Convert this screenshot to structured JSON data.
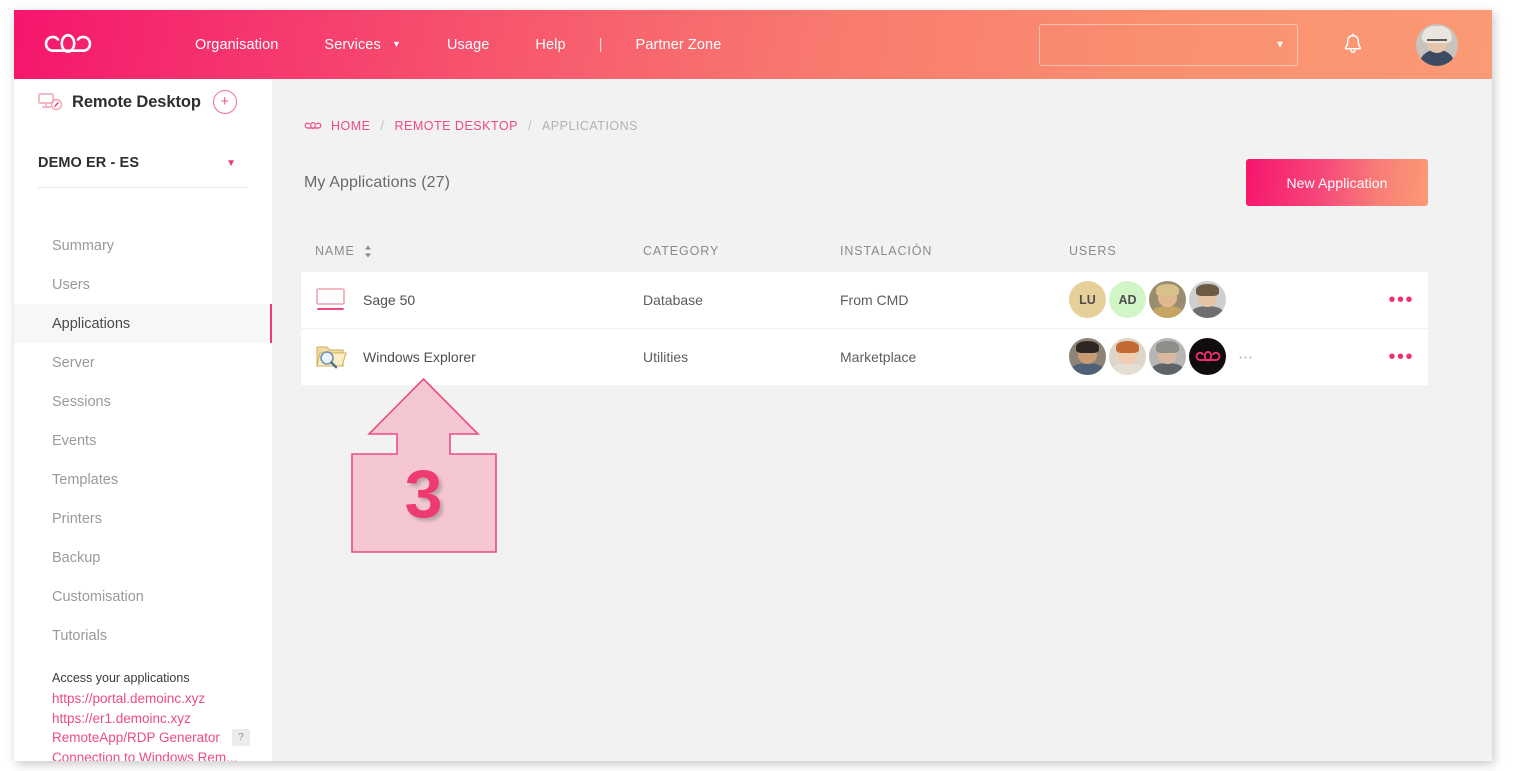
{
  "header": {
    "logo_icon": "cloud-logo-icon",
    "nav": [
      {
        "label": "Organisation",
        "has_caret": false
      },
      {
        "label": "Services",
        "has_caret": true
      },
      {
        "label": "Usage",
        "has_caret": false
      },
      {
        "label": "Help",
        "has_caret": false
      }
    ],
    "separator": "|",
    "partner_zone_label": "Partner Zone",
    "select_value": "",
    "select_caret": "▼",
    "bell_icon": "notification-bell-icon",
    "avatar_icon": "user-avatar"
  },
  "sidebar": {
    "service_title": "Remote Desktop",
    "service_icon": "remote-desktop-icon",
    "add_label": "+",
    "org_name": "DEMO ER - ES",
    "org_caret": "▼",
    "nav_items": [
      {
        "label": "Summary",
        "active": false
      },
      {
        "label": "Users",
        "active": false
      },
      {
        "label": "Applications",
        "active": true
      },
      {
        "label": "Server",
        "active": false
      },
      {
        "label": "Sessions",
        "active": false
      },
      {
        "label": "Events",
        "active": false
      },
      {
        "label": "Templates",
        "active": false
      },
      {
        "label": "Printers",
        "active": false
      },
      {
        "label": "Backup",
        "active": false
      },
      {
        "label": "Customisation",
        "active": false
      },
      {
        "label": "Tutorials",
        "active": false
      }
    ],
    "links_title": "Access your applications",
    "links": [
      "https://portal.demoinc.xyz",
      "https://er1.demoinc.xyz",
      "RemoteApp/RDP Generator",
      "Connection to Windows Rem..."
    ],
    "help_badge": "?"
  },
  "breadcrumb": {
    "logo_icon": "cloud-logo-icon",
    "items": [
      {
        "label": "HOME",
        "current": false
      },
      {
        "label": "REMOTE DESKTOP",
        "current": false
      },
      {
        "label": "APPLICATIONS",
        "current": true
      }
    ],
    "separator": "/"
  },
  "page": {
    "title": "My Applications (27)",
    "new_button": "New Application"
  },
  "table": {
    "columns": [
      {
        "key": "name",
        "label": "NAME",
        "sortable": true
      },
      {
        "key": "category",
        "label": "CATEGORY",
        "sortable": false
      },
      {
        "key": "installation",
        "label": "INSTALACIÓN",
        "sortable": false
      },
      {
        "key": "users",
        "label": "USERS",
        "sortable": false
      }
    ],
    "sort_icon": "sort-arrows-icon",
    "row_menu_icon": "more-options-icon",
    "rows": [
      {
        "icon": "monitor-icon",
        "name": "Sage 50",
        "category": "Database",
        "installation": "From CMD",
        "avatars": [
          {
            "type": "initials",
            "text": "LU",
            "bg": "#e6d09a"
          },
          {
            "type": "initials",
            "text": "AD",
            "bg": "#d2f5c7"
          },
          {
            "type": "photo",
            "bg": "#9a8d6f",
            "hair": "#d8c08a",
            "face": "#e0b890",
            "body": "#c6a463"
          },
          {
            "type": "photo",
            "bg": "#cfcfcf",
            "hair": "#6d5a45",
            "face": "#e6c3a4",
            "body": "#6f6f6f"
          }
        ],
        "avatars_overflow": ""
      },
      {
        "icon": "folder-search-icon",
        "name": "Windows Explorer",
        "category": "Utilities",
        "installation": "Marketplace",
        "avatars": [
          {
            "type": "photo",
            "bg": "#8d8376",
            "hair": "#2d2622",
            "face": "#c79b73",
            "body": "#4e6076"
          },
          {
            "type": "photo",
            "bg": "#ded5c9",
            "hair": "#c46a34",
            "face": "#f0cdb0",
            "body": "#e5ded3"
          },
          {
            "type": "photo",
            "bg": "#b6b6b4",
            "hair": "#8d8d8a",
            "face": "#d8b9a0",
            "body": "#5d6367"
          },
          {
            "type": "logo",
            "bg": "#120d0d",
            "logo_color": "#ee2e72"
          }
        ],
        "avatars_overflow": "⋯"
      }
    ]
  },
  "annotation": {
    "number": "3",
    "arrow_fill": "#f4c7d3",
    "arrow_stroke": "#ea4d7f",
    "number_color": "#ee3a6e"
  },
  "colors": {
    "brand_pink": "#f5156e",
    "brand_coral": "#fb9a74",
    "accent_link": "#ef4b80",
    "page_bg": "#f2f2f2",
    "panel_bg": "#ffffff"
  }
}
